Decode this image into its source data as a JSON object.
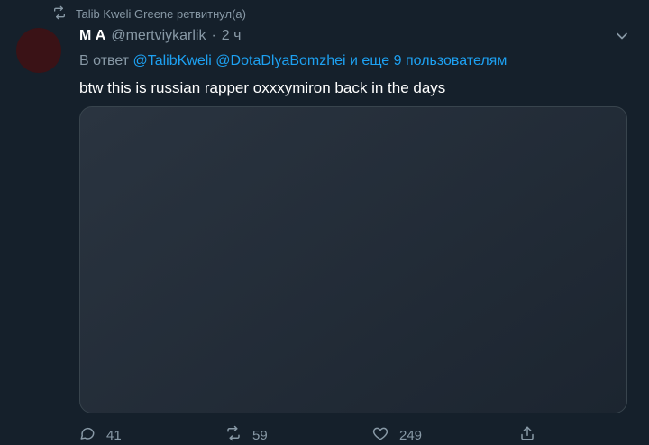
{
  "retweet_banner": {
    "icon": "retweet-icon",
    "text": "Talib Kweli Greene ретвитнул(а)"
  },
  "tweet": {
    "author_name": "М А",
    "handle": "@mertviykarlik",
    "separator": "·",
    "time": "2 ч",
    "reply_prefix": "В ответ",
    "reply_mentions": "@TalibKweli @DotaDlyaBomzhei и еще 9 пользователям",
    "text": "btw this is russian rapper oxxxymiron back in the days"
  },
  "actions": {
    "replies": "41",
    "retweets": "59",
    "likes": "249"
  },
  "colors": {
    "background": "#15202b",
    "muted": "#8899a6",
    "link": "#1da1f2"
  }
}
